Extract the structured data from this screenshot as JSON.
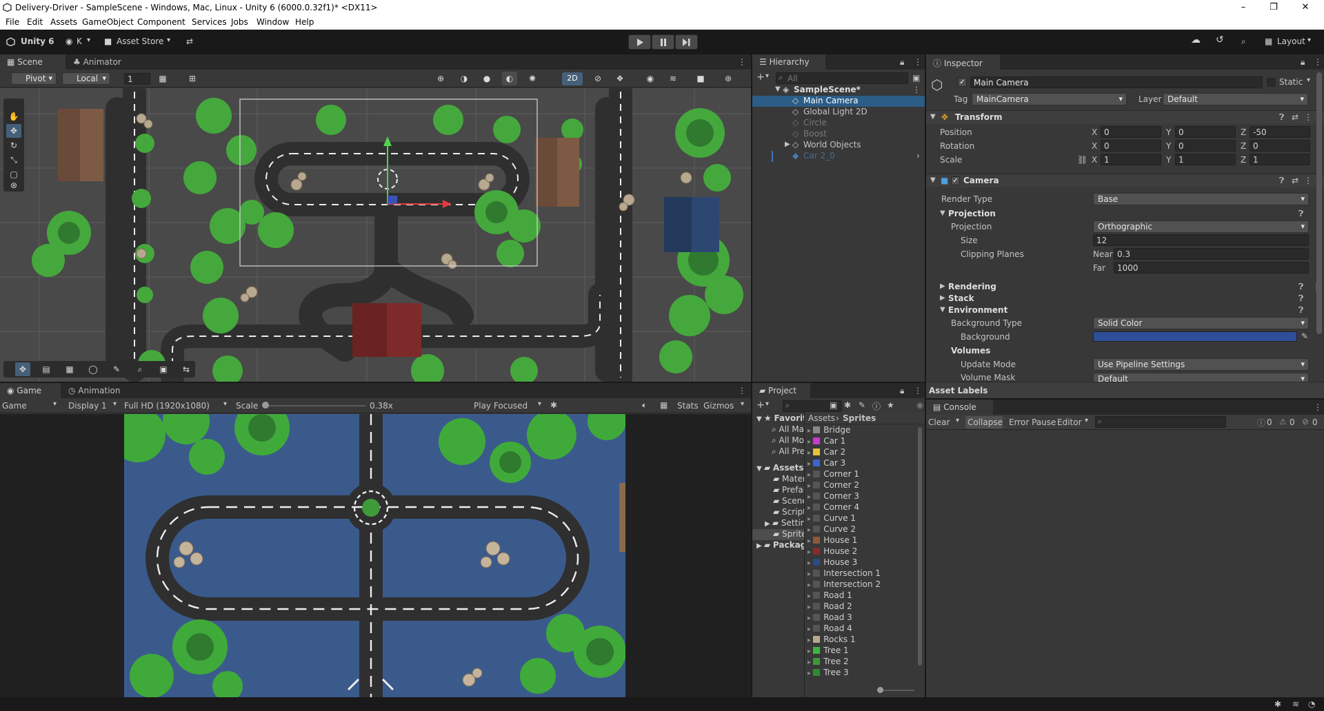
{
  "window": {
    "title": "Delivery-Driver - SampleScene - Windows, Mac, Linux - Unity 6 (6000.0.32f1)* <DX11>",
    "minimize": "–",
    "maximize": "❐",
    "close": "✕"
  },
  "menu": [
    "File",
    "Edit",
    "Assets",
    "GameObject",
    "Component",
    "Services",
    "Jobs",
    "Window",
    "Help"
  ],
  "toolbar": {
    "unity": "Unity 6",
    "account": "K",
    "asset_store": "Asset Store",
    "layout": "Layout"
  },
  "scene": {
    "tabs": [
      "Scene",
      "Animator"
    ],
    "pivot": "Pivot",
    "local": "Local",
    "grid_value": "1",
    "mode_2d": "2D"
  },
  "game": {
    "tabs": [
      "Game",
      "Animation"
    ],
    "display_mode": "Game",
    "display": "Display 1",
    "resolution": "Full HD (1920x1080)",
    "scale_label": "Scale",
    "scale_value": "0.38x",
    "play_focused": "Play Focused",
    "stats": "Stats",
    "gizmos": "Gizmos"
  },
  "hierarchy": {
    "tab": "Hierarchy",
    "search_placeholder": "All",
    "items": [
      {
        "label": "SampleScene*",
        "kind": "scene"
      },
      {
        "label": "Main Camera",
        "kind": "selected"
      },
      {
        "label": "Global Light 2D",
        "kind": "normal"
      },
      {
        "label": "Circle",
        "kind": "disabled"
      },
      {
        "label": "Boost",
        "kind": "disabled"
      },
      {
        "label": "World Objects",
        "kind": "normal"
      },
      {
        "label": "Car 2_0",
        "kind": "prefab-disabled"
      }
    ]
  },
  "inspector": {
    "tab": "Inspector",
    "object_name": "Main Camera",
    "static_label": "Static",
    "tag_label": "Tag",
    "tag_value": "MainCamera",
    "layer_label": "Layer",
    "layer_value": "Default",
    "transform": {
      "title": "Transform",
      "rows": [
        {
          "label": "Position",
          "x": "0",
          "y": "0",
          "z": "-50"
        },
        {
          "label": "Rotation",
          "x": "0",
          "y": "0",
          "z": "0"
        },
        {
          "label": "Scale",
          "x": "1",
          "y": "1",
          "z": "1"
        }
      ]
    },
    "camera": {
      "title": "Camera",
      "render_type_label": "Render Type",
      "render_type": "Base",
      "projection_section": "Projection",
      "projection_label": "Projection",
      "projection_value": "Orthographic",
      "size_label": "Size",
      "size_value": "12",
      "clipping_label": "Clipping Planes",
      "near_label": "Near",
      "near_value": "0.3",
      "far_label": "Far",
      "far_value": "1000",
      "rendering": "Rendering",
      "stack": "Stack",
      "environment": "Environment",
      "bg_type_label": "Background Type",
      "bg_type_value": "Solid Color",
      "background_label": "Background",
      "background_color": "#2e4e9a",
      "volumes": "Volumes",
      "update_mode_label": "Update Mode",
      "update_mode_value": "Use Pipeline Settings",
      "volume_mask_label": "Volume Mask",
      "volume_mask_value": "Default"
    },
    "asset_labels": "Asset Labels"
  },
  "project": {
    "tab": "Project",
    "favorites": "Favorites",
    "fav_items": [
      "All Materials",
      "All Models",
      "All Prefabs"
    ],
    "assets": "Assets",
    "asset_folders": [
      "Materials",
      "Prefabs",
      "Scenes",
      "Scripts",
      "Settings",
      "Sprites"
    ],
    "packages": "Packages",
    "breadcrumb": [
      "Assets",
      "Sprites"
    ],
    "sprites": [
      {
        "label": "Bridge",
        "color": "#888888"
      },
      {
        "label": "Car 1",
        "color": "#c93ad0"
      },
      {
        "label": "Car 2",
        "color": "#e6c33a"
      },
      {
        "label": "Car 3",
        "color": "#3a66d0"
      },
      {
        "label": "Corner 1",
        "color": "#555555"
      },
      {
        "label": "Corner 2",
        "color": "#555555"
      },
      {
        "label": "Corner 3",
        "color": "#555555"
      },
      {
        "label": "Corner 4",
        "color": "#555555"
      },
      {
        "label": "Curve 1",
        "color": "#555555"
      },
      {
        "label": "Curve 2",
        "color": "#555555"
      },
      {
        "label": "House 1",
        "color": "#8a5a3a"
      },
      {
        "label": "House 2",
        "color": "#8a2a2a"
      },
      {
        "label": "House 3",
        "color": "#2a4a8a"
      },
      {
        "label": "Intersection 1",
        "color": "#555555"
      },
      {
        "label": "Intersection 2",
        "color": "#555555"
      },
      {
        "label": "Road 1",
        "color": "#555555"
      },
      {
        "label": "Road 2",
        "color": "#555555"
      },
      {
        "label": "Road 3",
        "color": "#555555"
      },
      {
        "label": "Road 4",
        "color": "#555555"
      },
      {
        "label": "Rocks 1",
        "color": "#b8a890"
      },
      {
        "label": "Tree 1",
        "color": "#3ab83a"
      },
      {
        "label": "Tree 2",
        "color": "#3a9a3a"
      },
      {
        "label": "Tree 3",
        "color": "#2e8a2e"
      }
    ]
  },
  "console": {
    "tab": "Console",
    "clear": "Clear",
    "collapse": "Collapse",
    "error_pause": "Error Pause",
    "editor": "Editor",
    "log_count": "0",
    "warn_count": "0",
    "error_count": "0"
  },
  "colors": {
    "selection": "#2c5d87",
    "accent": "#3a79bb",
    "game_bg": "#3b5a8c"
  }
}
